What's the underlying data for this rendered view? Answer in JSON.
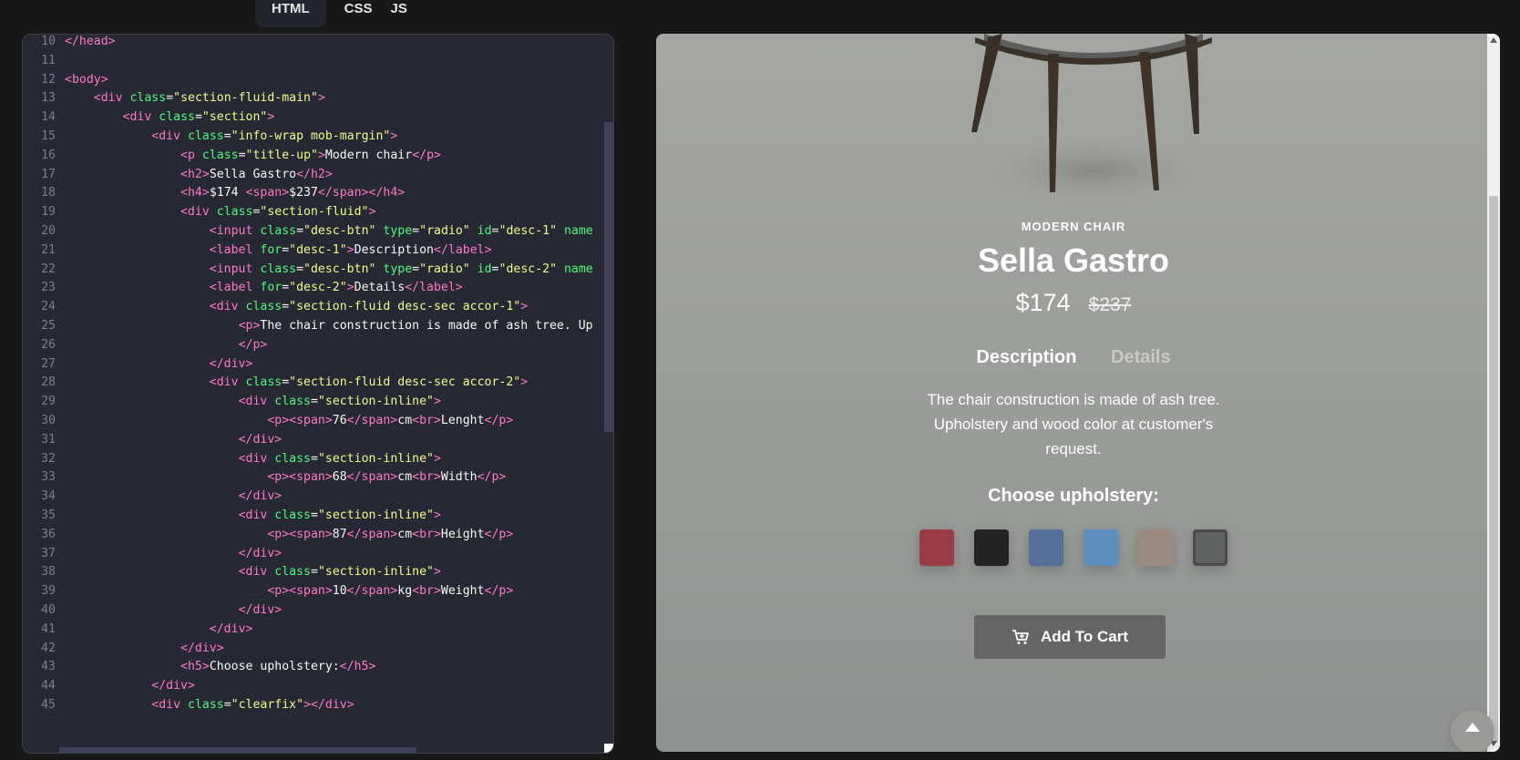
{
  "tabs": [
    "HTML",
    "CSS",
    "JS"
  ],
  "code_lines": [
    {
      "n": "10",
      "html": "<span class=\"t\">&lt;/head&gt;</span>"
    },
    {
      "n": "11",
      "html": ""
    },
    {
      "n": "12",
      "html": "<span class=\"t\">&lt;body&gt;</span>"
    },
    {
      "n": "13",
      "html": "    <span class=\"t\">&lt;div</span> <span class=\"a\">class</span><span class=\"x\">=</span><span class=\"s\">\"section-fluid-main\"</span><span class=\"t\">&gt;</span>"
    },
    {
      "n": "14",
      "html": "        <span class=\"t\">&lt;div</span> <span class=\"a\">class</span><span class=\"x\">=</span><span class=\"s\">\"section\"</span><span class=\"t\">&gt;</span>"
    },
    {
      "n": "15",
      "html": "            <span class=\"t\">&lt;div</span> <span class=\"a\">class</span><span class=\"x\">=</span><span class=\"s\">\"info-wrap mob-margin\"</span><span class=\"t\">&gt;</span>"
    },
    {
      "n": "16",
      "html": "                <span class=\"t\">&lt;p</span> <span class=\"a\">class</span><span class=\"x\">=</span><span class=\"s\">\"title-up\"</span><span class=\"t\">&gt;</span><span class=\"x\">Modern chair</span><span class=\"t\">&lt;/p&gt;</span>"
    },
    {
      "n": "17",
      "html": "                <span class=\"t\">&lt;h2&gt;</span><span class=\"x\">Sella Gastro</span><span class=\"t\">&lt;/h2&gt;</span>"
    },
    {
      "n": "18",
      "html": "                <span class=\"t\">&lt;h4&gt;</span><span class=\"x\">$174 </span><span class=\"t\">&lt;span&gt;</span><span class=\"x\">$237</span><span class=\"t\">&lt;/span&gt;&lt;/h4&gt;</span>"
    },
    {
      "n": "19",
      "html": "                <span class=\"t\">&lt;div</span> <span class=\"a\">class</span><span class=\"x\">=</span><span class=\"s\">\"section-fluid\"</span><span class=\"t\">&gt;</span>"
    },
    {
      "n": "20",
      "html": "                    <span class=\"t\">&lt;input</span> <span class=\"a\">class</span><span class=\"x\">=</span><span class=\"s\">\"desc-btn\"</span> <span class=\"a\">type</span><span class=\"x\">=</span><span class=\"s\">\"radio\"</span> <span class=\"a\">id</span><span class=\"x\">=</span><span class=\"s\">\"desc-1\"</span> <span class=\"a\">name</span>"
    },
    {
      "n": "21",
      "html": "                    <span class=\"t\">&lt;label</span> <span class=\"a\">for</span><span class=\"x\">=</span><span class=\"s\">\"desc-1\"</span><span class=\"t\">&gt;</span><span class=\"x\">Description</span><span class=\"t\">&lt;/label&gt;</span>"
    },
    {
      "n": "22",
      "html": "                    <span class=\"t\">&lt;input</span> <span class=\"a\">class</span><span class=\"x\">=</span><span class=\"s\">\"desc-btn\"</span> <span class=\"a\">type</span><span class=\"x\">=</span><span class=\"s\">\"radio\"</span> <span class=\"a\">id</span><span class=\"x\">=</span><span class=\"s\">\"desc-2\"</span> <span class=\"a\">name</span>"
    },
    {
      "n": "23",
      "html": "                    <span class=\"t\">&lt;label</span> <span class=\"a\">for</span><span class=\"x\">=</span><span class=\"s\">\"desc-2\"</span><span class=\"t\">&gt;</span><span class=\"x\">Details</span><span class=\"t\">&lt;/label&gt;</span>"
    },
    {
      "n": "24",
      "html": "                    <span class=\"t\">&lt;div</span> <span class=\"a\">class</span><span class=\"x\">=</span><span class=\"s\">\"section-fluid desc-sec accor-1\"</span><span class=\"t\">&gt;</span>"
    },
    {
      "n": "25",
      "html": "                        <span class=\"t\">&lt;p&gt;</span><span class=\"x\">The chair construction is made of ash tree. Up</span>"
    },
    {
      "n": "26",
      "html": "                        <span class=\"t\">&lt;/p&gt;</span>"
    },
    {
      "n": "27",
      "html": "                    <span class=\"t\">&lt;/div&gt;</span>"
    },
    {
      "n": "28",
      "html": "                    <span class=\"t\">&lt;div</span> <span class=\"a\">class</span><span class=\"x\">=</span><span class=\"s\">\"section-fluid desc-sec accor-2\"</span><span class=\"t\">&gt;</span>"
    },
    {
      "n": "29",
      "html": "                        <span class=\"t\">&lt;div</span> <span class=\"a\">class</span><span class=\"x\">=</span><span class=\"s\">\"section-inline\"</span><span class=\"t\">&gt;</span>"
    },
    {
      "n": "30",
      "html": "                            <span class=\"t\">&lt;p&gt;&lt;span&gt;</span><span class=\"x\">76</span><span class=\"t\">&lt;/span&gt;</span><span class=\"x\">cm</span><span class=\"t\">&lt;br&gt;</span><span class=\"x\">Lenght</span><span class=\"t\">&lt;/p&gt;</span>"
    },
    {
      "n": "31",
      "html": "                        <span class=\"t\">&lt;/div&gt;</span>"
    },
    {
      "n": "32",
      "html": "                        <span class=\"t\">&lt;div</span> <span class=\"a\">class</span><span class=\"x\">=</span><span class=\"s\">\"section-inline\"</span><span class=\"t\">&gt;</span>"
    },
    {
      "n": "33",
      "html": "                            <span class=\"t\">&lt;p&gt;&lt;span&gt;</span><span class=\"x\">68</span><span class=\"t\">&lt;/span&gt;</span><span class=\"x\">cm</span><span class=\"t\">&lt;br&gt;</span><span class=\"x\">Width</span><span class=\"t\">&lt;/p&gt;</span>"
    },
    {
      "n": "34",
      "html": "                        <span class=\"t\">&lt;/div&gt;</span>"
    },
    {
      "n": "35",
      "html": "                        <span class=\"t\">&lt;div</span> <span class=\"a\">class</span><span class=\"x\">=</span><span class=\"s\">\"section-inline\"</span><span class=\"t\">&gt;</span>"
    },
    {
      "n": "36",
      "html": "                            <span class=\"t\">&lt;p&gt;&lt;span&gt;</span><span class=\"x\">87</span><span class=\"t\">&lt;/span&gt;</span><span class=\"x\">cm</span><span class=\"t\">&lt;br&gt;</span><span class=\"x\">Height</span><span class=\"t\">&lt;/p&gt;</span>"
    },
    {
      "n": "37",
      "html": "                        <span class=\"t\">&lt;/div&gt;</span>"
    },
    {
      "n": "38",
      "html": "                        <span class=\"t\">&lt;div</span> <span class=\"a\">class</span><span class=\"x\">=</span><span class=\"s\">\"section-inline\"</span><span class=\"t\">&gt;</span>"
    },
    {
      "n": "39",
      "html": "                            <span class=\"t\">&lt;p&gt;&lt;span&gt;</span><span class=\"x\">10</span><span class=\"t\">&lt;/span&gt;</span><span class=\"x\">kg</span><span class=\"t\">&lt;br&gt;</span><span class=\"x\">Weight</span><span class=\"t\">&lt;/p&gt;</span>"
    },
    {
      "n": "40",
      "html": "                        <span class=\"t\">&lt;/div&gt;</span>"
    },
    {
      "n": "41",
      "html": "                    <span class=\"t\">&lt;/div&gt;</span>"
    },
    {
      "n": "42",
      "html": "                <span class=\"t\">&lt;/div&gt;</span>"
    },
    {
      "n": "43",
      "html": "                <span class=\"t\">&lt;h5&gt;</span><span class=\"x\">Choose upholstery:</span><span class=\"t\">&lt;/h5&gt;</span>"
    },
    {
      "n": "44",
      "html": "            <span class=\"t\">&lt;/div&gt;</span>"
    },
    {
      "n": "45",
      "html": "            <span class=\"t\">&lt;div</span> <span class=\"a\">class</span><span class=\"x\">=</span><span class=\"s\">\"clearfix\"</span><span class=\"t\">&gt;&lt;/div&gt;</span>"
    }
  ],
  "product": {
    "title_up": "MODERN CHAIR",
    "name": "Sella Gastro",
    "price": "$174",
    "old_price": "$237",
    "tabs": [
      "Description",
      "Details"
    ],
    "description": "The chair construction is made of ash tree. Upholstery and wood color at customer's request.",
    "choose_label": "Choose upholstery:",
    "swatches": [
      "#993c46",
      "#242424",
      "#546f98",
      "#5c8fbd",
      "#9d8a7f",
      "#5f6260"
    ],
    "selected_swatch": 5,
    "cart_label": "Add To Cart"
  },
  "icons": {
    "cart": "cart-icon",
    "to_top": "arrow-up-icon"
  }
}
